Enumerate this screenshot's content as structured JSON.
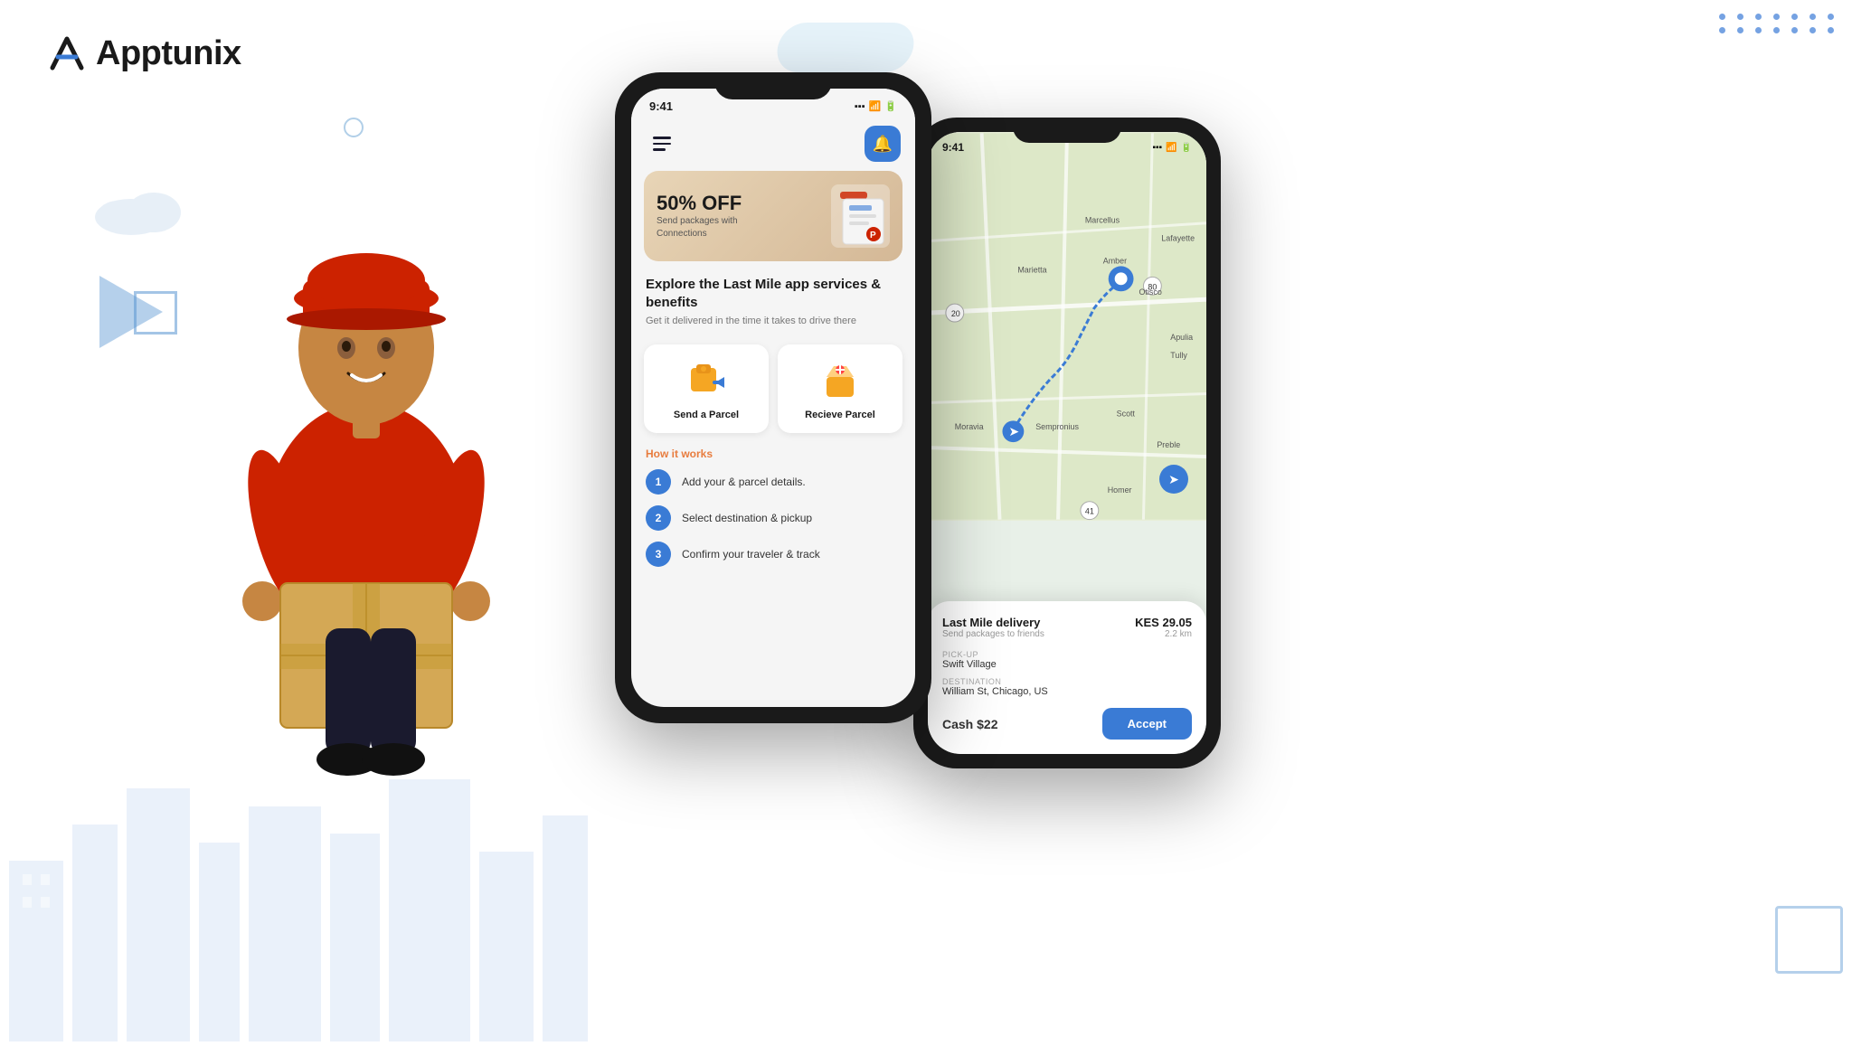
{
  "brand": {
    "name": "Apptunix",
    "logo_letter": "A"
  },
  "phone_main": {
    "status_time": "9:41",
    "banner": {
      "discount": "50% OFF",
      "line1": "Send packages with",
      "line2": "Connections"
    },
    "explore": {
      "title": "Explore the Last Mile app services & benefits",
      "subtitle": "Get it delivered in the time it takes to drive there"
    },
    "services": [
      {
        "label": "Send a Parcel"
      },
      {
        "label": "Recieve Parcel"
      }
    ],
    "how_it_works": {
      "title": "How it works",
      "steps": [
        {
          "num": "1",
          "text": "Add your & parcel details."
        },
        {
          "num": "2",
          "text": "Select destination & pickup"
        },
        {
          "num": "3",
          "text": "Confirm your traveler & track"
        }
      ]
    }
  },
  "phone_map": {
    "status_time": "9:41",
    "map_labels": [
      "Marcellus",
      "Marietta",
      "Amber",
      "Otisco",
      "Lafayette",
      "Sempronius",
      "Scott",
      "Homer",
      "Moravia",
      "Preble",
      "Apulia",
      "Tully"
    ],
    "delivery": {
      "title": "Last Mile delivery",
      "subtitle": "Send packages to friends",
      "price": "KES 29.05",
      "distance": "2.2 km",
      "pickup_label": "Pick-Up",
      "pickup_value": "Swift Village",
      "destination_label": "Destination",
      "destination_value": "William St, Chicago, US"
    },
    "actions": {
      "cash_label": "Cash $22",
      "accept_label": "Accept"
    }
  }
}
